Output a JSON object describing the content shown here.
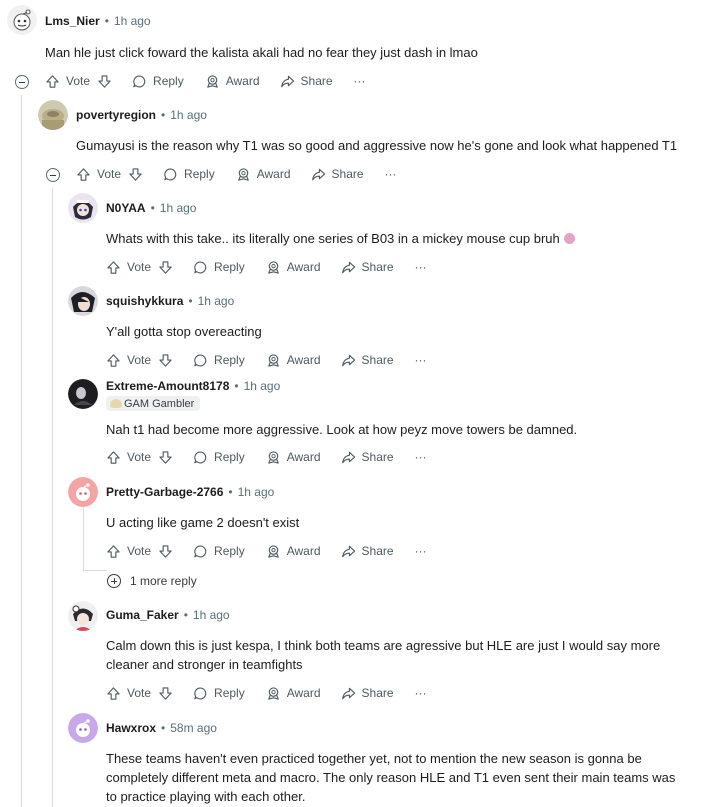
{
  "comments": [
    {
      "user": "Lms_Nier",
      "time": "1h ago",
      "lines": [
        "Man hle just click foward the kalista akali had no fear they just dash in lmao"
      ]
    },
    {
      "user": "povertyregion",
      "time": "1h ago",
      "lines": [
        "Gumayusi is the reason why T1 was so good and aggressive now he's gone and look what happened T1"
      ]
    },
    {
      "user": "N0YAA",
      "time": "1h ago",
      "lines": [
        "Whats with this take.. its literally one series of B03 in a mickey mouse cup bruh"
      ]
    },
    {
      "user": "squishykkura",
      "time": "1h ago",
      "lines": [
        "Y'all gotta stop overeacting"
      ]
    },
    {
      "user": "Extreme-Amount8178",
      "time": "1h ago",
      "flair": "GAM Gambler",
      "lines": [
        "Nah t1 had become more aggressive. Look at how peyz move towers be damned."
      ]
    },
    {
      "user": "Pretty-Garbage-2766",
      "time": "1h ago",
      "lines": [
        "U acting like game 2 doesn't exist"
      ]
    },
    {
      "user": "Guma_Faker",
      "time": "1h ago",
      "lines": [
        "Calm down this is just kespa, I think both teams are agressive but HLE are just I would say more",
        "cleaner and stronger in teamfights"
      ]
    },
    {
      "user": "Hawxrox",
      "time": "58m ago",
      "lines": [
        "These teams haven't even practiced together yet, not to mention the new season is gonna be",
        "completely different meta and macro. The only reason HLE and T1 even sent their main teams was",
        "to practice playing with each other."
      ]
    }
  ],
  "actions": {
    "vote": "Vote",
    "reply": "Reply",
    "award": "Award",
    "share": "Share",
    "more": "···"
  },
  "more_replies": "1 more reply",
  "icons": {
    "upvote": "arrow-up-icon",
    "downvote": "arrow-down-icon",
    "reply": "speech-bubble-icon",
    "award": "award-icon",
    "share": "share-arrow-icon",
    "more": "ellipsis-icon",
    "collapse": "minus-circle-icon",
    "expand": "plus-circle-icon"
  },
  "colors": {
    "text": "#1c1c1c",
    "meta": "#576f76",
    "thread_line": "#dadcde",
    "action_text": "#4c5a60"
  }
}
